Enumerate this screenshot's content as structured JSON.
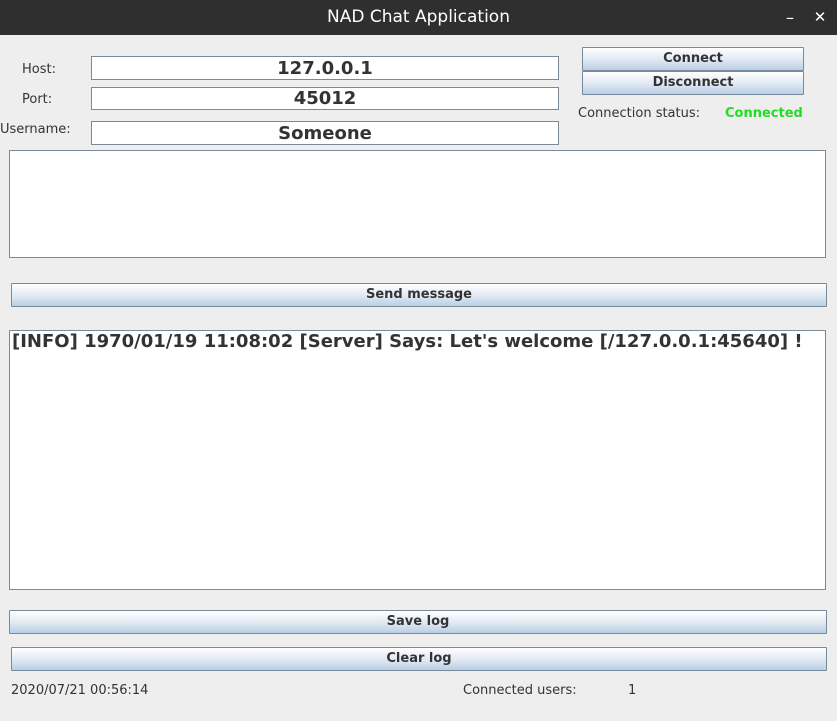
{
  "window": {
    "title": "NAD Chat Application",
    "minimize_label": "–",
    "close_label": "✕"
  },
  "connection": {
    "host_label": "Host:",
    "host_value": "127.0.0.1",
    "port_label": "Port:",
    "port_value": "45012",
    "username_label": "Username:",
    "username_value": "Someone",
    "connect_label": "Connect",
    "disconnect_label": "Disconnect",
    "status_label": "Connection status:",
    "status_value": "Connected",
    "status_color": "#22dd22"
  },
  "message": {
    "input_value": "",
    "send_label": "Send message"
  },
  "log": {
    "lines": [
      "[INFO] 1970/01/19 11:08:02 [Server] Says: Let's welcome [/127.0.0.1:45640] !"
    ],
    "save_label": "Save log",
    "clear_label": "Clear log"
  },
  "footer": {
    "timestamp": "2020/07/21 00:56:14",
    "users_label": "Connected users:",
    "users_count": "1"
  }
}
